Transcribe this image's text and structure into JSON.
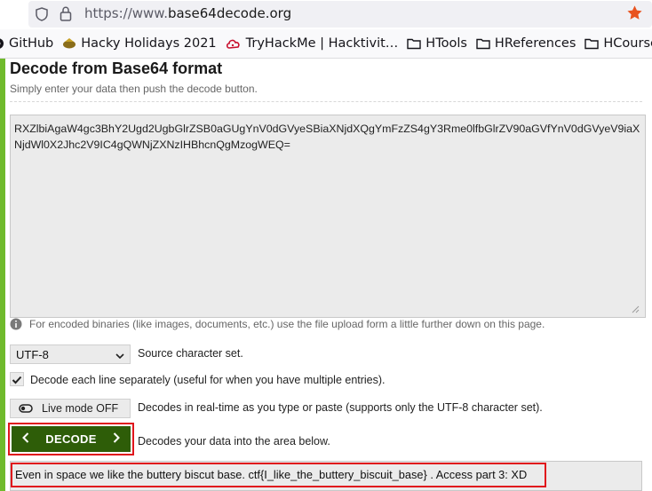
{
  "browser": {
    "url_scheme": "https://www.",
    "url_host": "base64decode.org",
    "bookmarks": [
      {
        "label": "GitHub",
        "icon": "github-icon"
      },
      {
        "label": "Hacky Holidays 2021",
        "icon": "hacky-holidays-icon"
      },
      {
        "label": "TryHackMe | Hacktivit…",
        "icon": "tryhackme-icon"
      },
      {
        "label": "HTools",
        "icon": "folder-icon"
      },
      {
        "label": "HReferences",
        "icon": "folder-icon"
      },
      {
        "label": "HCourses",
        "icon": "folder-icon"
      }
    ]
  },
  "page": {
    "title": "Decode from Base64 format",
    "subtitle": "Simply enter your data then push the decode button.",
    "input_text": "RXZlbiAgaW4gc3BhY2Ugd2UgbGlrZSB0aGUgYnV0dGVyeSBiaXNjdXQgYmFzZS4gY3Rme0lfbGlrZV90aGVfYnV0dGVyeV9iaXNjdWl0X2Jhc2V9IC4gQWNjZXNzIHBhcnQgMzogWEQ=",
    "info_text": "For encoded binaries (like images, documents, etc.) use the file upload form a little further down on this page.",
    "charset": {
      "value": "UTF-8",
      "label": "Source character set."
    },
    "decode_lines": {
      "checked": true,
      "label": "Decode each line separately (useful for when you have multiple entries)."
    },
    "live_mode": {
      "button": "Live mode OFF",
      "label": "Decodes in real-time as you type or paste (supports only the UTF-8 character set)."
    },
    "decode": {
      "button": "DECODE",
      "label": "Decodes your data into the area below."
    },
    "output_text": "Even  in space we like the buttery biscut base. ctf{I_like_the_buttery_biscuit_base} . Access part 3: XD"
  },
  "colors": {
    "accent_green": "#2e5d08",
    "side_bar_green": "#6fba2c",
    "highlight_red": "#e0151c",
    "star_orange": "#e8531f"
  }
}
